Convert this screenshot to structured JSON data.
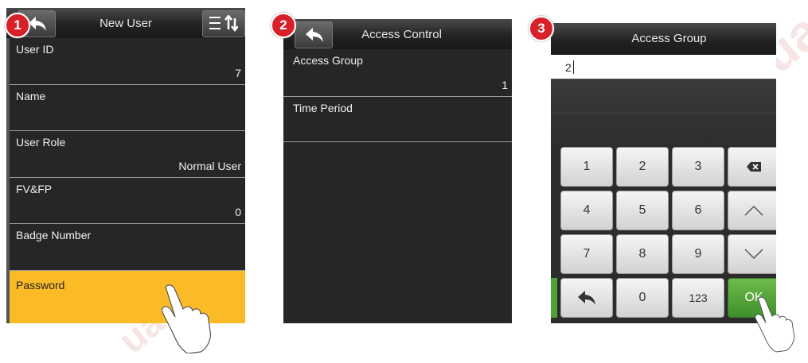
{
  "screen1": {
    "badge": "1",
    "title": "New User",
    "rows": [
      {
        "label": "User ID",
        "value": "7"
      },
      {
        "label": "Name",
        "value": ""
      },
      {
        "label": "User Role",
        "value": "Normal User"
      },
      {
        "label": "FV&FP",
        "value": "0"
      },
      {
        "label": "Badge Number",
        "value": ""
      },
      {
        "label": "Password",
        "value": ""
      }
    ]
  },
  "screen2": {
    "badge": "2",
    "title": "Access Control",
    "rows": [
      {
        "label": "Access Group",
        "value": "1"
      },
      {
        "label": "Time Period",
        "value": ""
      }
    ]
  },
  "screen3": {
    "badge": "3",
    "title": "Access Group",
    "input_value": "2",
    "keys": {
      "k1": "1",
      "k2": "2",
      "k3": "3",
      "k4": "4",
      "k5": "5",
      "k6": "6",
      "k7": "7",
      "k8": "8",
      "k9": "9",
      "k0": "0",
      "k123": "123",
      "ok": "OK"
    }
  },
  "colors": {
    "highlight": "#fbbb26",
    "ok_green": "#4ea236",
    "badge_red": "#d8202a"
  },
  "watermark": {
    "top": "www.sec.ua",
    "bottom": "ua"
  }
}
